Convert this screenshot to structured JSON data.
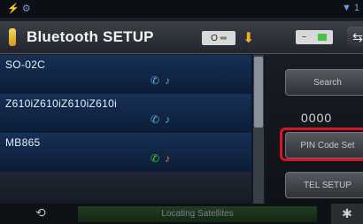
{
  "status": {
    "left_icons": "⚡ ⚙",
    "right_icons": "▼ 1"
  },
  "header": {
    "title": "Bluetooth SETUP",
    "box_text": "O ═",
    "back": "⇆"
  },
  "devices": [
    {
      "name": "SO-02C",
      "phone_active": false,
      "music_active": false
    },
    {
      "name": "Z610iZ610iZ610iZ610i",
      "phone_active": false,
      "music_active": false
    },
    {
      "name": "MB865",
      "phone_active": true,
      "music_active": true
    }
  ],
  "buttons": {
    "search": "Search",
    "pin_code_set": "PIN Code Set",
    "tel_setup": "TEL SETUP"
  },
  "pin_value": "0000",
  "bottom": {
    "status": "Locating Satellites"
  },
  "icons": {
    "phone": "✆",
    "music": "♪",
    "nav_left": "⟲",
    "nav_right": "✱"
  }
}
